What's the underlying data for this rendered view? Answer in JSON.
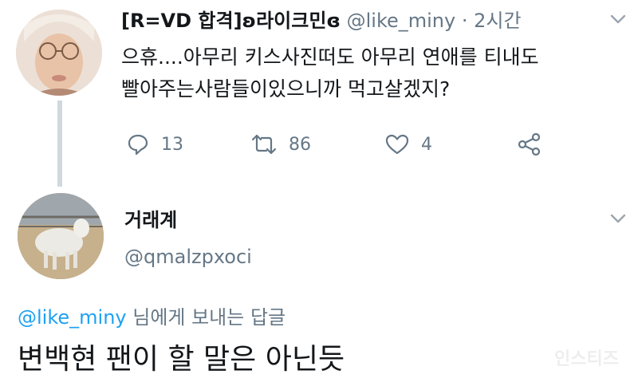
{
  "tweet": {
    "display_name": "[R=VD 합격]ʚ라이크민ɞ",
    "handle": "@like_miny",
    "separator": "·",
    "time": "2시간",
    "text_line1": "으휴....아무리 키스사진떠도 아무리 연애를 티내도",
    "text_line2": "빨아주는사람들이있으니까 먹고살겠지?",
    "actions": {
      "reply_count": "13",
      "retweet_count": "86",
      "like_count": "4"
    }
  },
  "reply": {
    "display_name": "거래계",
    "handle": "@qmalzpxoci",
    "replying_to_mention": "@like_miny",
    "replying_to_suffix": " 님에게 보내는 답글",
    "text": "변백현 팬이 할 말은 아닌듯"
  },
  "watermark": "인스티즈",
  "icons": [
    "reply-icon",
    "retweet-icon",
    "like-icon",
    "share-icon",
    "chevron-down-icon"
  ],
  "colors": {
    "text": "#14171a",
    "secondary": "#657786",
    "link": "#1da1f2",
    "thread_line": "#cfd9de"
  }
}
